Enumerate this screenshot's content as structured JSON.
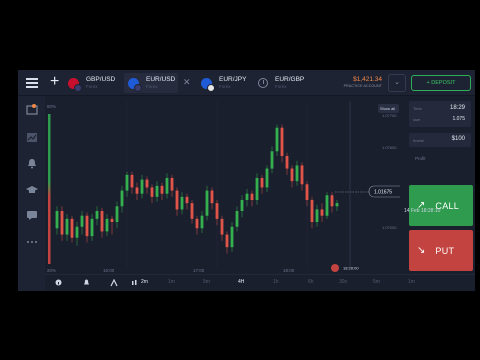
{
  "header": {
    "tabs": [
      {
        "pair": "GBP/USD",
        "sub": "Forex",
        "colors": [
          "#c8102e",
          "#3c3b6e"
        ]
      },
      {
        "pair": "EUR/USD",
        "sub": "Forex",
        "colors": [
          "#1f5bd6",
          "#3c3b6e"
        ]
      },
      {
        "pair": "EUR/JPY",
        "sub": "Forex",
        "colors": [
          "#1f5bd6",
          "#e8e8e8"
        ]
      },
      {
        "pair": "EUR/GBP",
        "sub": "Forex"
      }
    ],
    "balance": "$1,421.34",
    "account_label": "PRACTICE ACCOUNT",
    "deposit_label": "+ DEPOSIT"
  },
  "chart": {
    "top_pct": "80%",
    "bottom_pct": "20%",
    "show_all": "Show all",
    "current_price": "1.01675",
    "y_ticks": [
      "1.07700",
      "1.07600",
      "1.07000"
    ],
    "x_ticks": [
      "16:00",
      "17:00",
      "18:00"
    ],
    "expiry_label": "18:28:00"
  },
  "chart_data": {
    "type": "candlestick",
    "candles": [
      [
        1.0154,
        1.0165,
        1.015,
        1.0168
      ],
      [
        1.0165,
        1.015,
        1.0146,
        1.0168
      ],
      [
        1.015,
        1.016,
        1.0146,
        1.0163
      ],
      [
        1.016,
        1.0148,
        1.0145,
        1.0162
      ],
      [
        1.0148,
        1.0155,
        1.0143,
        1.0158
      ],
      [
        1.0155,
        1.0162,
        1.015,
        1.0165
      ],
      [
        1.0162,
        1.0149,
        1.0145,
        1.0164
      ],
      [
        1.0149,
        1.016,
        1.0146,
        1.0163
      ],
      [
        1.016,
        1.0165,
        1.0156,
        1.0168
      ],
      [
        1.0165,
        1.0152,
        1.0148,
        1.0167
      ],
      [
        1.0152,
        1.016,
        1.0149,
        1.0163
      ],
      [
        1.016,
        1.0158,
        1.015,
        1.0162
      ],
      [
        1.0158,
        1.0168,
        1.0154,
        1.0171
      ],
      [
        1.0168,
        1.0178,
        1.0164,
        1.0181
      ],
      [
        1.0178,
        1.0188,
        1.0174,
        1.019
      ],
      [
        1.0188,
        1.018,
        1.0176,
        1.019
      ],
      [
        1.018,
        1.0176,
        1.0172,
        1.0183
      ],
      [
        1.0176,
        1.0185,
        1.0173,
        1.0188
      ],
      [
        1.0185,
        1.018,
        1.0176,
        1.0187
      ],
      [
        1.018,
        1.0174,
        1.017,
        1.0182
      ],
      [
        1.0174,
        1.0181,
        1.0171,
        1.0184
      ],
      [
        1.0181,
        1.0176,
        1.0172,
        1.0183
      ],
      [
        1.0176,
        1.0186,
        1.0173,
        1.0189
      ],
      [
        1.0186,
        1.0178,
        1.0174,
        1.0188
      ],
      [
        1.0178,
        1.0166,
        1.0162,
        1.018
      ],
      [
        1.0166,
        1.0174,
        1.0163,
        1.0177
      ],
      [
        1.0174,
        1.017,
        1.0166,
        1.0176
      ],
      [
        1.017,
        1.016,
        1.0157,
        1.0172
      ],
      [
        1.016,
        1.0154,
        1.015,
        1.0162
      ],
      [
        1.0154,
        1.0162,
        1.0151,
        1.0165
      ],
      [
        1.0162,
        1.0178,
        1.0159,
        1.0181
      ],
      [
        1.0178,
        1.017,
        1.0166,
        1.018
      ],
      [
        1.017,
        1.016,
        1.0156,
        1.0172
      ],
      [
        1.016,
        1.015,
        1.0146,
        1.0162
      ],
      [
        1.015,
        1.0142,
        1.0138,
        1.0152
      ],
      [
        1.0142,
        1.0155,
        1.0139,
        1.0158
      ],
      [
        1.0155,
        1.0165,
        1.0152,
        1.0168
      ],
      [
        1.0165,
        1.0172,
        1.0161,
        1.0175
      ],
      [
        1.0172,
        1.0176,
        1.0168,
        1.0179
      ],
      [
        1.0176,
        1.0172,
        1.0168,
        1.0178
      ],
      [
        1.0172,
        1.0186,
        1.0169,
        1.0189
      ],
      [
        1.0186,
        1.018,
        1.0176,
        1.0188
      ],
      [
        1.018,
        1.0192,
        1.0177,
        1.0194
      ],
      [
        1.0192,
        1.0203,
        1.0189,
        1.0206
      ],
      [
        1.0203,
        1.0218,
        1.02,
        1.022
      ],
      [
        1.0218,
        1.02,
        1.0196,
        1.022
      ],
      [
        1.02,
        1.0192,
        1.0188,
        1.0202
      ],
      [
        1.0192,
        1.0184,
        1.018,
        1.0194
      ],
      [
        1.0184,
        1.0194,
        1.0181,
        1.0197
      ],
      [
        1.0194,
        1.0182,
        1.0178,
        1.0196
      ],
      [
        1.0182,
        1.0172,
        1.0168,
        1.0184
      ],
      [
        1.0172,
        1.0158,
        1.0154,
        1.0174
      ],
      [
        1.0158,
        1.0166,
        1.0155,
        1.0169
      ],
      [
        1.0166,
        1.0162,
        1.0158,
        1.017
      ],
      [
        1.0162,
        1.0175,
        1.016,
        1.0177
      ],
      [
        1.0175,
        1.0168,
        1.0164,
        1.0177
      ],
      [
        1.0168,
        1.017,
        1.0165,
        1.0172
      ]
    ],
    "ylim": [
      1.013,
      1.0235
    ],
    "colors": {
      "up": "#35b04f",
      "down": "#e05548"
    }
  },
  "bottombar": {
    "items": [
      "2m",
      "1m",
      "5m",
      "4H",
      "1h",
      "6h",
      "30s",
      "5m",
      "1m"
    ],
    "datetime": "14 Feb 18:28:10"
  },
  "panel": {
    "time_label": "Time",
    "time_value": "18:29",
    "size_label": "size",
    "size_value": "1.075",
    "amount_label": "Invest",
    "amount_value": "$100",
    "profit_label": "Profit",
    "call_label": "CALL",
    "put_label": "PUT"
  },
  "colors": {
    "background": "#1a1f2e",
    "call": "#2f9b4e",
    "put": "#c2433f",
    "accent": "#f2894a"
  }
}
